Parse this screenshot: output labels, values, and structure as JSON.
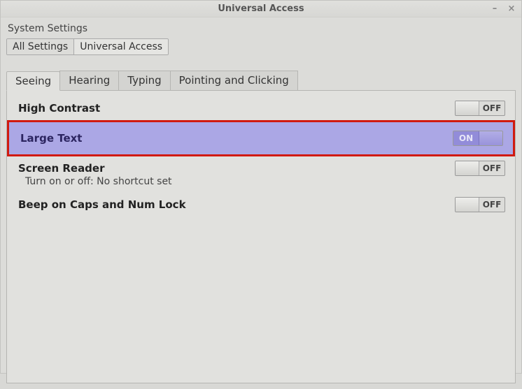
{
  "window": {
    "title": "Universal Access"
  },
  "page": {
    "header": "System Settings"
  },
  "breadcrumb": {
    "all": "All Settings",
    "current": "Universal Access"
  },
  "tabs": {
    "seeing": "Seeing",
    "hearing": "Hearing",
    "typing": "Typing",
    "pointing": "Pointing and Clicking"
  },
  "options": {
    "highContrast": {
      "label": "High Contrast",
      "state": "OFF"
    },
    "largeText": {
      "label": "Large Text",
      "state": "ON"
    },
    "screenReader": {
      "label": "Screen Reader",
      "state": "OFF",
      "sub": "Turn on or off:  No shortcut set"
    },
    "beepCaps": {
      "label": "Beep on Caps and Num Lock",
      "state": "OFF"
    }
  }
}
